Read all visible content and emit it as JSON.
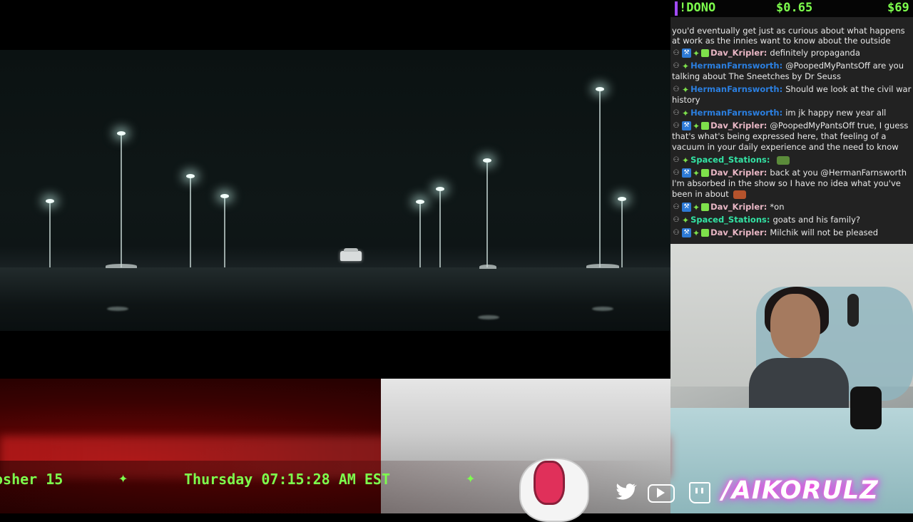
{
  "dono_bar": {
    "label": "!DONO",
    "amount_small": "$0.65",
    "amount_large": "$69"
  },
  "chat": {
    "previous_fragment": "you'd eventually get just as curious about what happens at work as the innies want to know about the outside",
    "messages": [
      {
        "user": "Dav_Kripler",
        "text": "definitely propaganda",
        "color": "pink",
        "badges": [
          "mod",
          "verified",
          "sub",
          "gift"
        ]
      },
      {
        "user": "HermanFarnsworth",
        "text": "@PoopedMyPantsOff are you talking about The Sneetches by Dr Seuss",
        "color": "blue",
        "badges": [
          "mod",
          "sub"
        ]
      },
      {
        "user": "HermanFarnsworth",
        "text": "Should we look at the civil war history",
        "color": "blue",
        "badges": [
          "mod",
          "sub"
        ]
      },
      {
        "user": "HermanFarnsworth",
        "text": "im jk happy new year all",
        "color": "blue",
        "badges": [
          "mod",
          "sub"
        ]
      },
      {
        "user": "Dav_Kripler",
        "text": "@PoopedMyPantsOff true, I guess that's what's being expressed here, that feeling of a vacuum in your daily experience and the need to know",
        "color": "pink",
        "badges": [
          "mod",
          "verified",
          "sub",
          "gift"
        ]
      },
      {
        "user": "Spaced_Stations",
        "text": "",
        "color": "green",
        "badges": [
          "mod",
          "sub"
        ],
        "emote": "frog-emote"
      },
      {
        "user": "Dav_Kripler",
        "text": "back at you @HermanFarnsworth I'm absorbed in the show so I have no idea what you've been in about",
        "color": "pink",
        "badges": [
          "mod",
          "verified",
          "sub",
          "gift"
        ],
        "emote": "face-emote"
      },
      {
        "user": "Dav_Kripler",
        "text": "*on",
        "color": "pink",
        "badges": [
          "mod",
          "verified",
          "sub",
          "gift"
        ]
      },
      {
        "user": "Spaced_Stations",
        "text": "goats and his family?",
        "color": "green",
        "badges": [
          "mod",
          "sub"
        ]
      },
      {
        "user": "Dav_Kripler",
        "text": "Milchik will not be pleased",
        "color": "pink",
        "badges": [
          "mod",
          "verified",
          "sub",
          "gift"
        ]
      }
    ]
  },
  "ticker": {
    "segment1": "osher 15",
    "segment2": "Thursday 07:15:28 AM EST",
    "separator": "✦"
  },
  "branding": {
    "handle": "/AIKORULZ",
    "socials": [
      "twitter-icon",
      "youtube-icon",
      "twitch-icon"
    ]
  },
  "colors": {
    "ticker_green": "#7dff4d",
    "dono_bar_accent": "#a24bff",
    "chat_bg": "#222222",
    "handle_glow": "#ff4ed8"
  }
}
